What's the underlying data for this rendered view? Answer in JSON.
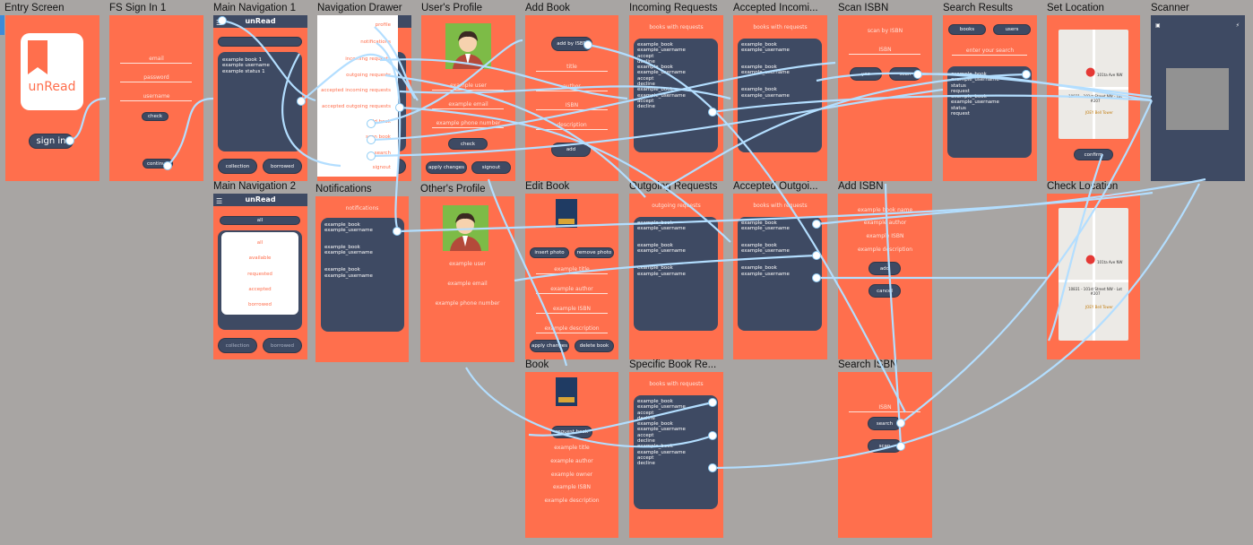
{
  "frames": {
    "entry": {
      "title": "Entry Screen",
      "logo_text": "unRead",
      "sign_in": "sign in"
    },
    "fs_sign_in": {
      "title": "FS Sign In 1",
      "email": "email",
      "password": "password",
      "username": "username",
      "check": "check",
      "continue": "continue"
    },
    "main_nav_1": {
      "title": "Main Navigation 1",
      "app_name": "unRead",
      "list": "example book 1\nexample username\nexample status 1",
      "collection": "collection",
      "borrowed": "borrowed"
    },
    "main_nav_2": {
      "title": "Main Navigation 2",
      "app_name": "unRead",
      "filter": "all",
      "options": [
        "all",
        "available",
        "requested",
        "accepted",
        "borrowed"
      ],
      "collection": "collection",
      "borrowed": "borrowed"
    },
    "nav_drawer": {
      "title": "Navigation Drawer",
      "items": [
        "profile",
        "notifications",
        "incoming requests",
        "outgoing requests",
        "accepted incoming requests",
        "accepted outgoing requests",
        "add book",
        "scan book",
        "search",
        "signout"
      ]
    },
    "notifications": {
      "title": "Notifications",
      "header": "notifications",
      "list": "example_book\nexample_username\n\n\nexample_book\nexample_username\n\n\nexample_book\nexample_username"
    },
    "users_profile": {
      "title": "User's Profile",
      "username": "example user",
      "email": "example email",
      "phone": "example phone number",
      "check": "check",
      "apply": "apply changes",
      "signout": "signout"
    },
    "others_profile": {
      "title": "Other's Profile",
      "username": "example user",
      "email": "example email",
      "phone": "example phone number"
    },
    "add_book": {
      "title": "Add Book",
      "add_isbn": "add by ISBN",
      "fields": [
        "title",
        "author",
        "ISBN",
        "description"
      ],
      "add": "add"
    },
    "edit_book": {
      "title": "Edit Book",
      "insert": "insert photo",
      "remove": "remove photo",
      "fields": [
        "example title",
        "example author",
        "example ISBN",
        "example description"
      ],
      "apply": "apply changes",
      "delete": "delete book"
    },
    "book": {
      "title": "Book",
      "request": "request book",
      "fields": [
        "example title",
        "example author",
        "example owner",
        "example ISBN",
        "example description"
      ]
    },
    "incoming": {
      "title": "Incoming Requests",
      "header": "books with requests",
      "list": "example_book\nexample_username\naccept\ndecline\nexample_book\nexample_username\naccept\ndecline\nexample_book\nexample_username\naccept\ndecline"
    },
    "outgoing": {
      "title": "Outgoing Requests",
      "header": "outgoing requests",
      "list": "example_book\nexample_username\n\n\nexample_book\nexample_username\n\n\nexample_book\nexample_username"
    },
    "specific": {
      "title": "Specific Book Re...",
      "header": "books with requests",
      "list": "example_book\nexample_username\naccept\ndecline\nexample_book\nexample_username\naccept\ndecline\nexample_book\nexample_username\naccept\ndecline"
    },
    "acc_incoming": {
      "title": "Accepted Incomi...",
      "header": "books with requests",
      "list": "example_book\nexample_username\n\n\nexample_book\nexample_username\n\n\nexample_book\nexample_username"
    },
    "acc_outgoing": {
      "title": "Accepted Outgoi...",
      "header": "books with requests",
      "list": "example_book\nexample_username\n\n\nexample_book\nexample_username\n\n\nexample_book\nexample_username"
    },
    "scan_isbn": {
      "title": "Scan ISBN",
      "header": "scan by ISBN",
      "field": "ISBN",
      "yes": "yes",
      "scan": "scan"
    },
    "add_isbn": {
      "title": "Add ISBN",
      "fields": [
        "example book name",
        "example author",
        "example ISBN",
        "example description"
      ],
      "add": "add",
      "cancel": "cancel"
    },
    "search_isbn": {
      "title": "Search ISBN",
      "field": "ISBN",
      "search": "search",
      "scan": "scan"
    },
    "search_results": {
      "title": "Search Results",
      "books": "books",
      "users": "users",
      "placeholder": "enter your search",
      "list": "example_book\nexample_username\nstatus\nrequest\nexample_book\nexample_username\nstatus\nrequest"
    },
    "set_location": {
      "title": "Set Location",
      "confirm": "confirm",
      "map_label_1": "101ta Ave NW",
      "map_label_2": "10831 - 101st Street NW - Lot #207",
      "map_label_3": "JOEY Bell Tower"
    },
    "check_location": {
      "title": "Check Location",
      "map_label_1": "101ta Ave NW",
      "map_label_2": "10831 - 101st Street NW - Lot #207",
      "map_label_3": "JOEY Bell Tower"
    },
    "scanner": {
      "title": "Scanner"
    }
  },
  "colors": {
    "canvas": "#a8a5a3",
    "screen": "#ff6f4d",
    "card": "#3e4a63",
    "wire": "#b3deff"
  }
}
